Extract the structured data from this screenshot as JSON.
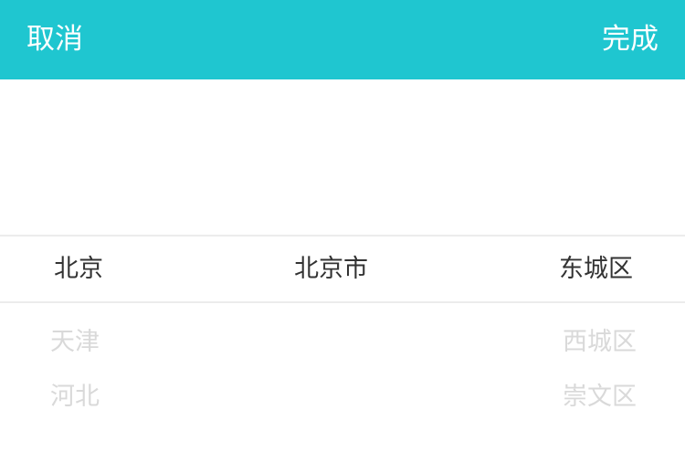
{
  "header": {
    "cancel_label": "取消",
    "done_label": "完成",
    "background_color": "#1fc6d0"
  },
  "picker": {
    "province": {
      "selected": "北京",
      "below": [
        "天津",
        "河北"
      ]
    },
    "city": {
      "selected": "北京市"
    },
    "district": {
      "selected": "东城区",
      "below": [
        "西城区",
        "崇文区"
      ]
    }
  }
}
